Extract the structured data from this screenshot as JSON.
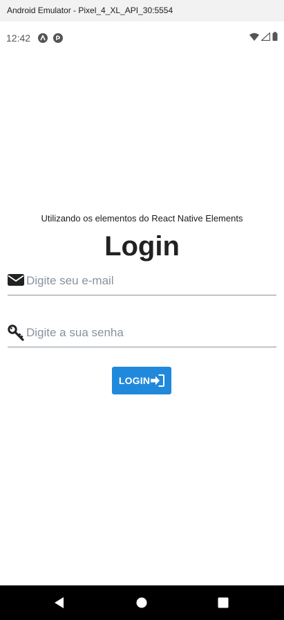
{
  "window": {
    "title": "Android Emulator - Pixel_4_XL_API_30:5554"
  },
  "status_bar": {
    "time": "12:42",
    "notification_icons": [
      "react-native-icon",
      "expo-go-icon"
    ],
    "system_icons": [
      "wifi-icon",
      "cell-signal-icon",
      "battery-icon"
    ]
  },
  "screen": {
    "subtitle": "Utilizando os elementos do React Native Elements",
    "title": "Login",
    "email_field": {
      "placeholder": "Digite seu e-mail",
      "value": "",
      "icon": "envelope-icon"
    },
    "password_field": {
      "placeholder": "Digite a sua senha",
      "value": "",
      "icon": "key-icon"
    },
    "login_button": {
      "label": "LOGIN",
      "icon": "sign-in-icon"
    }
  },
  "nav_bar": {
    "buttons": [
      "back",
      "home",
      "recents"
    ]
  },
  "colors": {
    "primary": "#2089dc",
    "input_border": "#86939e",
    "placeholder": "#86939e",
    "title_text": "#222222",
    "nav_background": "#000000",
    "titlebar_background": "#f2f2f2"
  }
}
